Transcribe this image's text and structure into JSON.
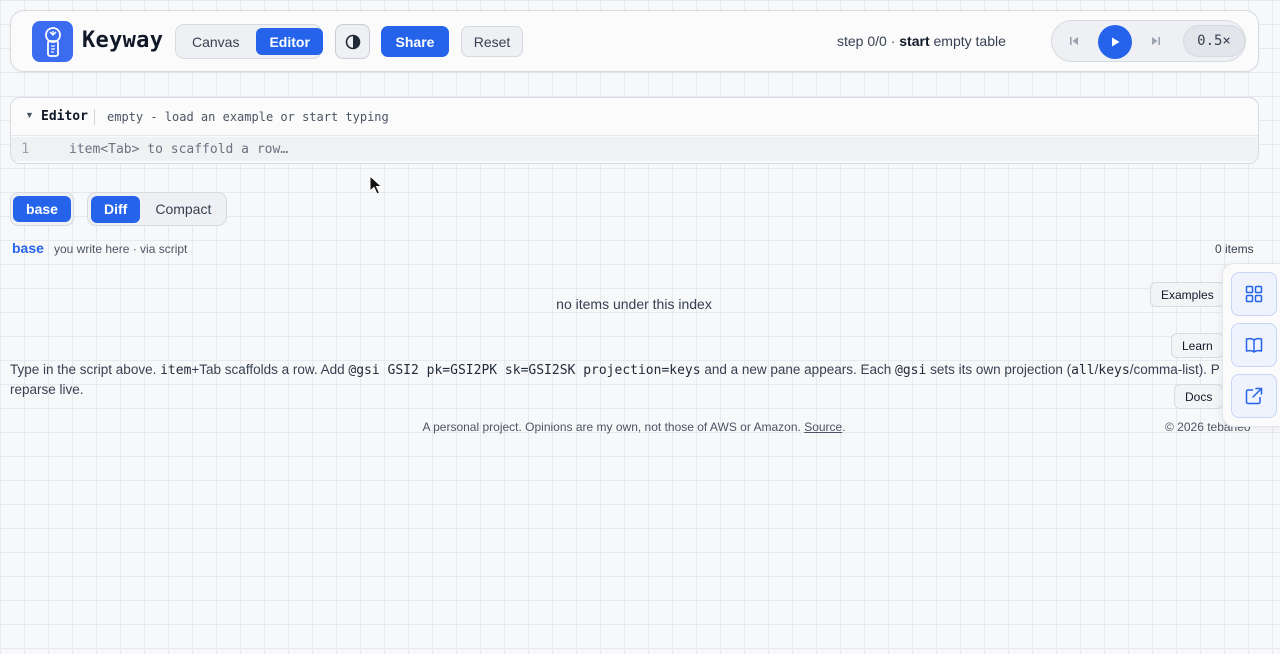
{
  "app": {
    "brand": "Keyway"
  },
  "header": {
    "mode_tabs": [
      {
        "label": "Canvas",
        "active": false
      },
      {
        "label": "Editor",
        "active": true
      }
    ],
    "theme_icon": "contrast-icon",
    "share_label": "Share",
    "reset_label": "Reset",
    "step_prefix": "step 0/0 ·",
    "step_keyword": "start",
    "step_suffix": "empty table",
    "player": {
      "first_icon": "skip-back-icon",
      "play_icon": "play-icon",
      "next_icon": "skip-forward-icon",
      "speed": "0.5×"
    }
  },
  "editor": {
    "title": "Editor",
    "hint": "empty - load an example or start typing",
    "line_number": "1",
    "placeholder": "item<Tab> to scaffold a row…"
  },
  "panes": {
    "index_tabs": [
      {
        "label": "base",
        "active": true
      }
    ],
    "view_tabs": [
      {
        "label": "Diff",
        "active": true
      },
      {
        "label": "Compact",
        "active": false
      }
    ]
  },
  "pane": {
    "name": "base",
    "description": "you write here · via script",
    "count": "0 items",
    "empty_message": "no items under this index"
  },
  "help": {
    "t1": "Type in the script above. ",
    "c1": "item",
    "t2": "+Tab scaffolds a row. Add ",
    "c2": "@gsi GSI2 pk=GSI2PK sk=GSI2SK projection=keys",
    "t3": " and a new pane appears. Each ",
    "c3": "@gsi",
    "t4": " sets its own projection (",
    "c4": "all",
    "t5": "/",
    "c5": "keys",
    "t6": "/comma-list). P",
    "t7": "reparse live."
  },
  "footer": {
    "text": "A personal project. Opinions are my own, not those of AWS or Amazon. ",
    "link": "Source",
    "end": ".",
    "copyright": "© 2026 tebarieo"
  },
  "dock": {
    "items": [
      {
        "label": "Examples",
        "icon": "grid-icon"
      },
      {
        "label": "Learn",
        "icon": "book-icon"
      },
      {
        "label": "Docs",
        "icon": "external-link-icon"
      }
    ]
  },
  "colors": {
    "accent": "#2563eb",
    "logo_bg": "#3b6cf0"
  }
}
